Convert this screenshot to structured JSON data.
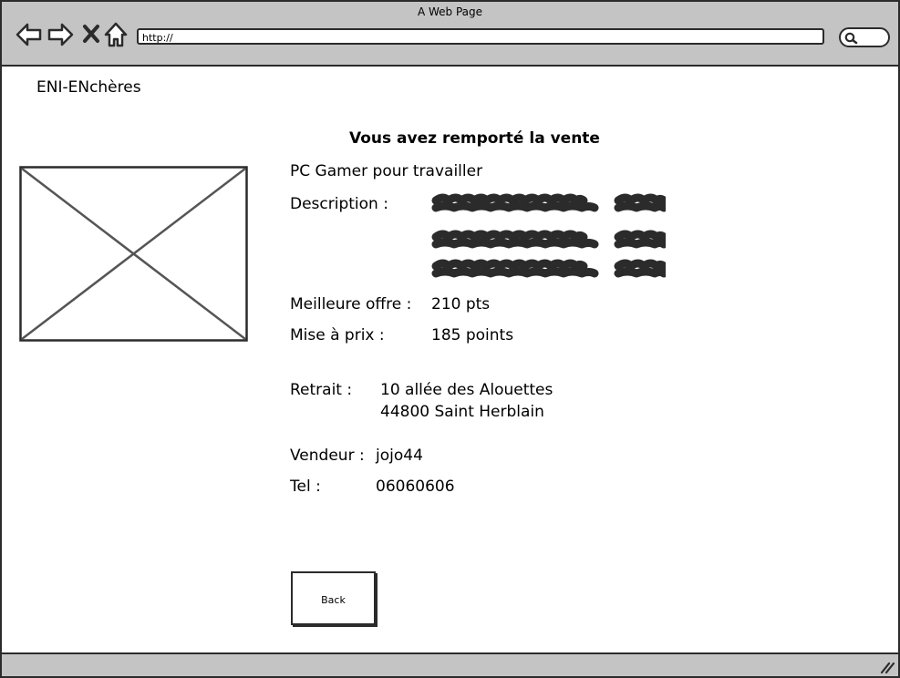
{
  "window": {
    "title": "A Web Page",
    "url": "http://"
  },
  "icons": {
    "back": "arrow-left-icon",
    "forward": "arrow-right-icon",
    "stop": "close-icon",
    "home": "home-icon",
    "search": "search-icon",
    "image": "image-placeholder-icon",
    "resize": "resize-grip-icon"
  },
  "site": {
    "name": "ENI-ENchères"
  },
  "sale": {
    "heading": "Vous avez remporté la vente",
    "item_title": "PC Gamer pour travailler",
    "description_label": "Description :",
    "best_offer_label": "Meilleure offre :",
    "best_offer_value": "210 pts",
    "start_price_label": "Mise à prix :",
    "start_price_value": "185 points",
    "pickup_label": "Retrait :",
    "pickup_line1": "10 allée des Alouettes",
    "pickup_line2": "44800 Saint Herblain",
    "seller_label": "Vendeur :",
    "seller_value": "jojo44",
    "phone_label": "Tel :",
    "phone_value": "06060606"
  },
  "actions": {
    "back_label": "Back"
  },
  "colors": {
    "chrome": "#c4c4c4",
    "stroke": "#2b2b2b",
    "background": "#ffffff"
  }
}
